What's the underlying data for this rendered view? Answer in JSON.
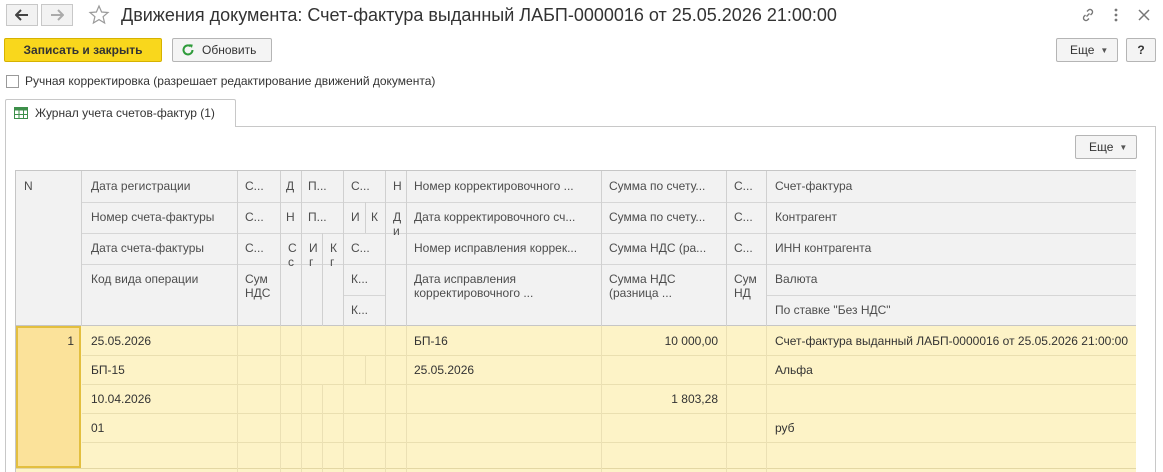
{
  "window": {
    "title": "Движения документа: Счет-фактура выданный ЛАБП-0000016 от 25.05.2026 21:00:00",
    "icons": {
      "back": "arrow-left-icon",
      "forward": "arrow-right-icon",
      "favorite": "star-icon",
      "link": "link-icon",
      "menu": "more-vertical-icon",
      "close": "close-icon"
    }
  },
  "toolbar": {
    "save_close": "Записать и закрыть",
    "refresh": "Обновить",
    "more": "Еще",
    "help": "?"
  },
  "manual_edit": {
    "label": "Ручная корректировка (разрешает редактирование движений документа)",
    "checked": false
  },
  "tab": {
    "label": "Журнал учета счетов-фактур (1)"
  },
  "grid": {
    "more": "Еще",
    "headers": {
      "n": "N",
      "col1": [
        "Дата регистрации",
        "Номер счета-фактуры",
        "Дата счета-фактуры",
        "Код вида операции"
      ],
      "col2": [
        "С...",
        "С...",
        "С...",
        "Сум НДС"
      ],
      "col3": [
        "Д",
        "Н",
        "С с",
        ""
      ],
      "col4": [
        "П...",
        "П...",
        "И г",
        ""
      ],
      "col5": [
        "",
        "",
        "К г",
        ""
      ],
      "col6": [
        "С...",
        "И",
        "С...",
        "К...",
        "К..."
      ],
      "col6b": "К",
      "col7": [
        "Н",
        "Д и",
        "",
        ""
      ],
      "col8": [
        "Номер корректировочного ...",
        "Дата корректировочного сч...",
        "Номер исправления коррек...",
        "Дата исправления корректировочного ..."
      ],
      "col9": [
        "Сумма по счету...",
        "Сумма по счету...",
        "Сумма НДС (ра...",
        "Сумма НДС (разница ..."
      ],
      "col10": [
        "С...",
        "С...",
        "С...",
        "Сум НД"
      ],
      "col11": [
        "Счет-фактура",
        "Контрагент",
        "ИНН контрагента",
        "Валюта",
        "По ставке \"Без НДС\""
      ]
    },
    "row": {
      "n": "1",
      "col1": [
        "25.05.2026",
        "БП-15",
        "10.04.2026",
        "01"
      ],
      "col8": [
        "БП-16",
        "25.05.2026"
      ],
      "col9": [
        "10 000,00",
        "1 803,28"
      ],
      "col11": [
        "Счет-фактура выданный ЛАБП-0000016 от 25.05.2026 21:00:00",
        "Альфа",
        "",
        "руб"
      ]
    }
  },
  "colors": {
    "primary": "#f9d71c",
    "selection": "#fdf3c7",
    "header": "#f2f2f2"
  }
}
